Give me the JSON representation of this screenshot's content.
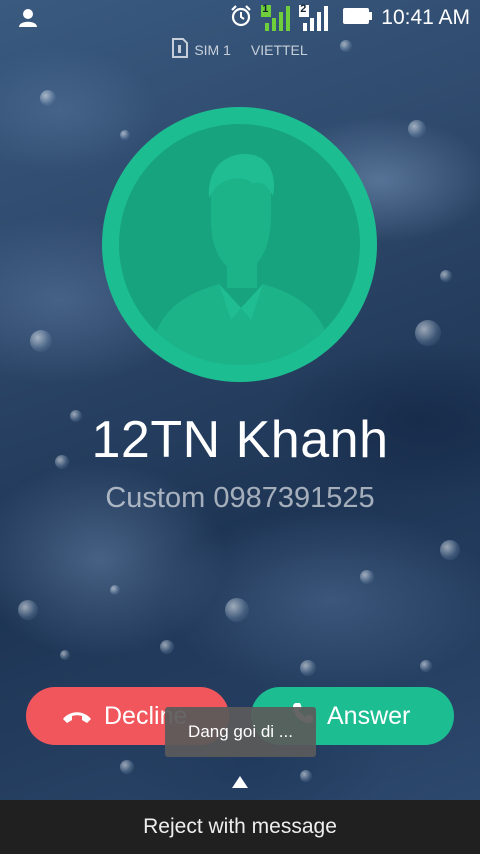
{
  "status_bar": {
    "time": "10:41 AM",
    "sim_label": "SIM 1",
    "operator": "VIETTEL",
    "sim1_badge": "1",
    "sim2_badge": "2"
  },
  "caller": {
    "name": "12TN Khanh",
    "number": "Custom 0987391525"
  },
  "actions": {
    "decline_label": "Decline",
    "answer_label": "Answer",
    "reject_with_message": "Reject with message"
  },
  "toast": {
    "text": "Dang goi di ..."
  },
  "colors": {
    "avatar_ring": "#1dbd92",
    "avatar_fill": "#17a37d",
    "decline": "#f0565c",
    "answer": "#1dbd92",
    "signal_sim1": "#6fcf3a"
  },
  "icons": {
    "user": "user-icon",
    "alarm": "alarm-clock-icon",
    "battery": "battery-icon",
    "decline": "phone-hangup-icon",
    "answer": "phone-answer-icon",
    "swipe": "arrow-up-icon"
  }
}
